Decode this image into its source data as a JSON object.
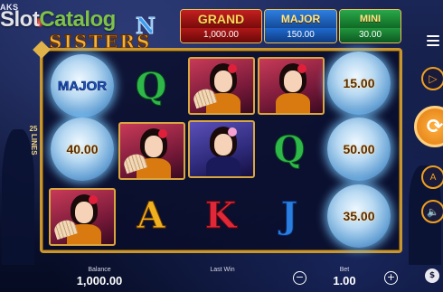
{
  "corner_text": "AKS",
  "watermark": {
    "part1": "Slot",
    "part2": "Catalog"
  },
  "logo": {
    "title_fragment": "N",
    "subtitle": "SISTERS"
  },
  "jackpots": {
    "grand": {
      "label": "GRAND",
      "value": "1,000.00"
    },
    "major": {
      "label": "MAJOR",
      "value": "150.00"
    },
    "mini": {
      "label": "MINI",
      "value": "30.00"
    }
  },
  "paylines": {
    "count": "25",
    "word": "LINES"
  },
  "reels": {
    "r1c1": "MAJOR",
    "r1c5": "15.00",
    "r2c1": "40.00",
    "r2c5": "50.00",
    "r3c5": "35.00",
    "q_symbol": "Q",
    "a_symbol": "A",
    "k_symbol": "K",
    "j_symbol": "J"
  },
  "icons": {
    "skip": "▷",
    "spin": "⟳",
    "auto": "A",
    "sound": "🔈",
    "minus": "−",
    "plus": "+",
    "coins": "$"
  },
  "bottom": {
    "balance_label": "Balance",
    "balance_value": "1,000.00",
    "lastwin_label": "Last Win",
    "lastwin_value": "",
    "bet_label": "Bet",
    "bet_value": "1.00"
  }
}
